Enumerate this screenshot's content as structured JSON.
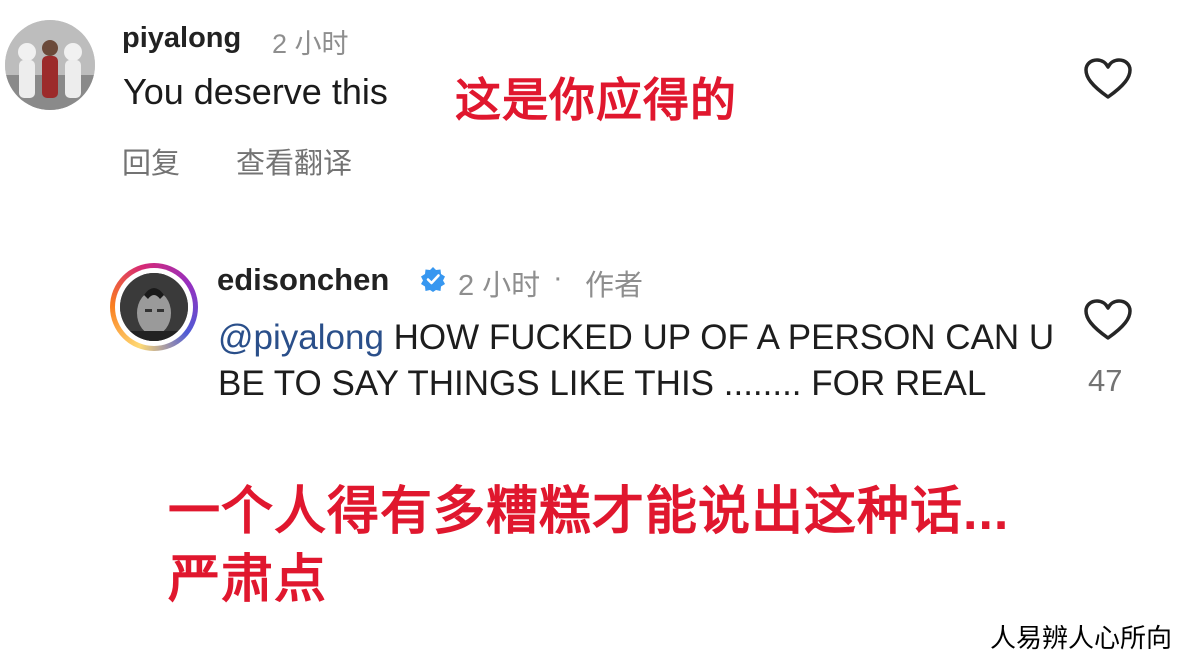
{
  "comments": [
    {
      "username": "piyalong",
      "time": "2 小时",
      "text": "You deserve this",
      "translation": "这是你应得的",
      "actions": {
        "reply": "回复",
        "see_translation": "查看翻译"
      }
    },
    {
      "username": "edisonchen",
      "verified": true,
      "time": "2 小时",
      "separator": "·",
      "author_label": "作者",
      "mention": "@piyalong",
      "text": " HOW FUCKED UP OF A PERSON CAN U BE TO SAY THINGS LIKE THIS ........ FOR REAL",
      "likes": "47",
      "translation_line1": "一个人得有多糟糕才能说出这种话...",
      "translation_line2": "严肃点"
    }
  ],
  "watermark": "人易辨人心所向",
  "colors": {
    "accent_red": "#e0172e",
    "mention_blue": "#2a4f8a",
    "verified_blue": "#3797f0"
  }
}
